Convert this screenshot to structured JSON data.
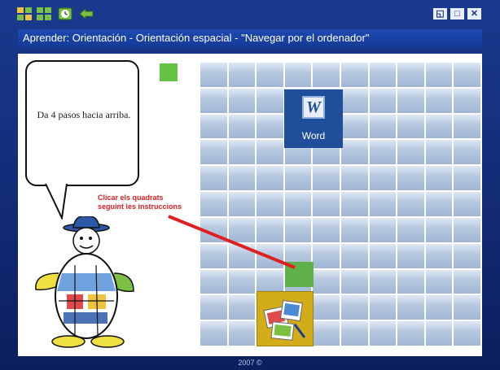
{
  "window": {
    "title": "Aprender: Orientación - Orientación espacial - \"Navegar por el ordenador\"",
    "controls": {
      "restore": "◱",
      "maximize": "□",
      "close": "✕"
    }
  },
  "toolbar": {
    "icons": [
      "grid-icon",
      "grid-icon",
      "clock-icon",
      "back-arrow-icon"
    ]
  },
  "speech_bubble": {
    "text": "Da 4 pasos hacia arriba."
  },
  "hint": {
    "line1": "Clicar els quadrats",
    "line2": "seguint les instruccions"
  },
  "board": {
    "columns": 10,
    "rows": 11,
    "word_tile": {
      "label": "Word",
      "icon_letter": "W"
    },
    "target_cell": {
      "row": 7,
      "col": 3
    },
    "picture_tile_icon": "image-editor-icon"
  },
  "footer": {
    "copyright": "2007 ©"
  },
  "colors": {
    "frame": "#143b98",
    "board": "#b7c9e0",
    "green": "#66c244",
    "hint_red": "#e02020",
    "tile_yellow": "#d3ad19"
  }
}
